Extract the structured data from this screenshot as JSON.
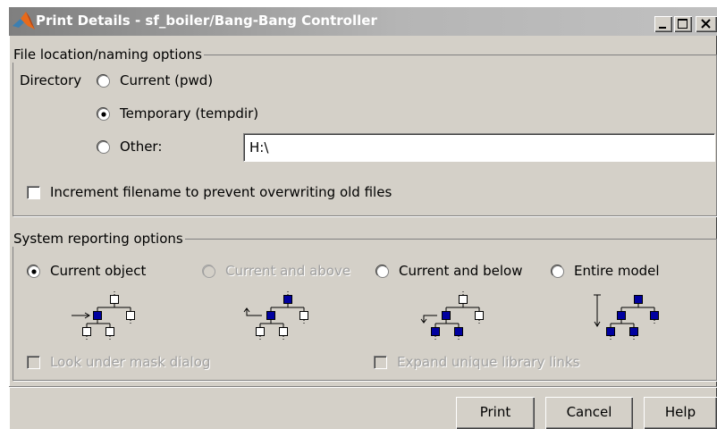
{
  "window": {
    "title": "Print Details - sf_boiler/Bang-Bang Controller"
  },
  "file_options": {
    "legend": "File location/naming options",
    "directory_label": "Directory",
    "radio_current": "Current (pwd)",
    "radio_temporary": "Temporary (tempdir)",
    "radio_other": "Other:",
    "selected": "Temporary (tempdir)",
    "other_path_value": "H:\\",
    "increment_label": "Increment filename to prevent overwriting old files",
    "increment_checked": false
  },
  "system_options": {
    "legend": "System reporting options",
    "radio_current_object": "Current object",
    "radio_current_above": "Current and above",
    "radio_current_below": "Current and below",
    "radio_entire_model": "Entire model",
    "selected": "Current object",
    "look_under_mask_label": "Look under mask dialog",
    "expand_library_label": "Expand unique library links"
  },
  "buttons": {
    "print": "Print",
    "cancel": "Cancel",
    "help": "Help"
  },
  "colors": {
    "dialog_bg": "#d4d0c8",
    "title_bar": "#808080",
    "selected_block": "#0000a0",
    "disabled_text": "#a0a0a0"
  },
  "icons": [
    "matlab-logo-icon",
    "minimize-icon",
    "maximize-icon",
    "close-icon",
    "hierarchy-diagram-icon"
  ]
}
